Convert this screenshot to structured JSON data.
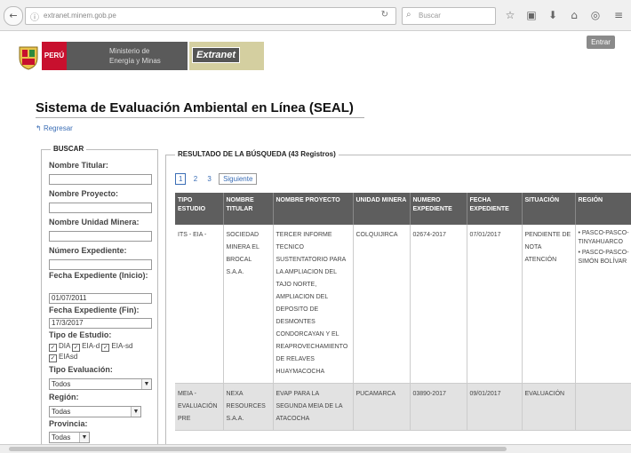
{
  "browser": {
    "url": "extranet.minem.gob.pe",
    "search_placeholder": "Buscar"
  },
  "header": {
    "peru_label": "PERÚ",
    "ministry_line1": "Ministerio de",
    "ministry_line2": "Energía y Minas",
    "extranet_label": "Extranet",
    "exit_label": "Entrar"
  },
  "page": {
    "title": "Sistema de Evaluación Ambiental en Línea (SEAL)",
    "back_link": "Regresar"
  },
  "search": {
    "legend": "BUSCAR",
    "titular_label": "Nombre Titular:",
    "titular_value": "",
    "project_label": "Nombre Proyecto:",
    "project_value": "",
    "unit_label": "Nombre Unidad Minera:",
    "unit_value": "",
    "file_label": "Número Expediente:",
    "file_value": "",
    "date_start_label": "Fecha Expediente (Inicio):",
    "date_start_value": "01/07/2011",
    "date_end_label": "Fecha Expediente (Fin):",
    "date_end_value": "17/3/2017",
    "study_type_label": "Tipo de Estudio:",
    "study_types": [
      "DIA",
      "EIA-d",
      "EIA-sd",
      "EIAsd"
    ],
    "eval_type_label": "Tipo Evaluación:",
    "eval_type_value": "Todos",
    "region_label": "Región:",
    "region_value": "Todas",
    "province_label": "Provincia:",
    "province_value": "Todas"
  },
  "results": {
    "legend": "RESULTADO DE LA BÚSQUEDA (43 Registros)",
    "pages": [
      "1",
      "2",
      "3"
    ],
    "next_label": "Siguiente",
    "columns": [
      "TIPO ESTUDIO",
      "NOMBRE TITULAR",
      "NOMBRE PROYECTO",
      "UNIDAD MINERA",
      "NUMERO EXPEDIENTE",
      "FECHA EXPEDIENTE",
      "SITUACIÓN",
      "REGIÓN"
    ],
    "rows": [
      {
        "tipo": "ITS - EIA -",
        "titular": "SOCIEDAD MINERA EL BROCAL S.A.A.",
        "proyecto": "TERCER INFORME TECNICO SUSTENTATORIO PARA LA AMPLIACION DEL TAJO NORTE, AMPLIACION DEL DEPOSITO DE DESMONTES CONDORCAYAN Y EL REAPROVECHAMIENTO DE RELAVES HUAYMACOCHA",
        "unidad": "COLQUIJIRCA",
        "expediente": "02674-2017",
        "fecha": "07/01/2017",
        "situacion": "PENDIENTE DE NOTA ATENCIÓN",
        "region": [
          "PASCO-PASCO-TINYAHUARCO",
          "PASCO-PASCO-SIMÓN BOLÍVAR"
        ]
      },
      {
        "tipo": "MEIA - EVALUACIÓN PRE",
        "titular": "NEXA RESOURCES S.A.A.",
        "proyecto": "EVAP PARA LA SEGUNDA MEIA DE LA ATACOCHA",
        "unidad": "PUCAMARCA",
        "expediente": "03890-2017",
        "fecha": "09/01/2017",
        "situacion": "EVALUACIÓN",
        "region": []
      }
    ]
  }
}
